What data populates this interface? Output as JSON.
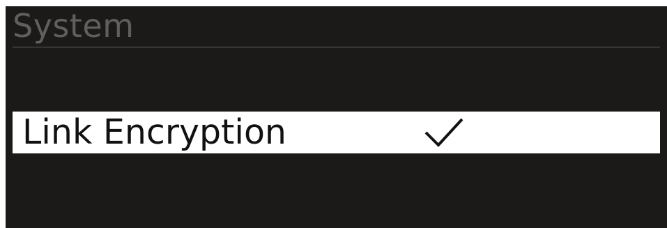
{
  "header": {
    "title": "System"
  },
  "menu": {
    "selected_item": {
      "label": "Link Encryption",
      "checked": true,
      "status_icon": "checkmark-icon"
    }
  },
  "colors": {
    "background": "#1b1a18",
    "header_text": "#5f5f5d",
    "highlight": "#ffffff",
    "highlight_text": "#111111"
  }
}
